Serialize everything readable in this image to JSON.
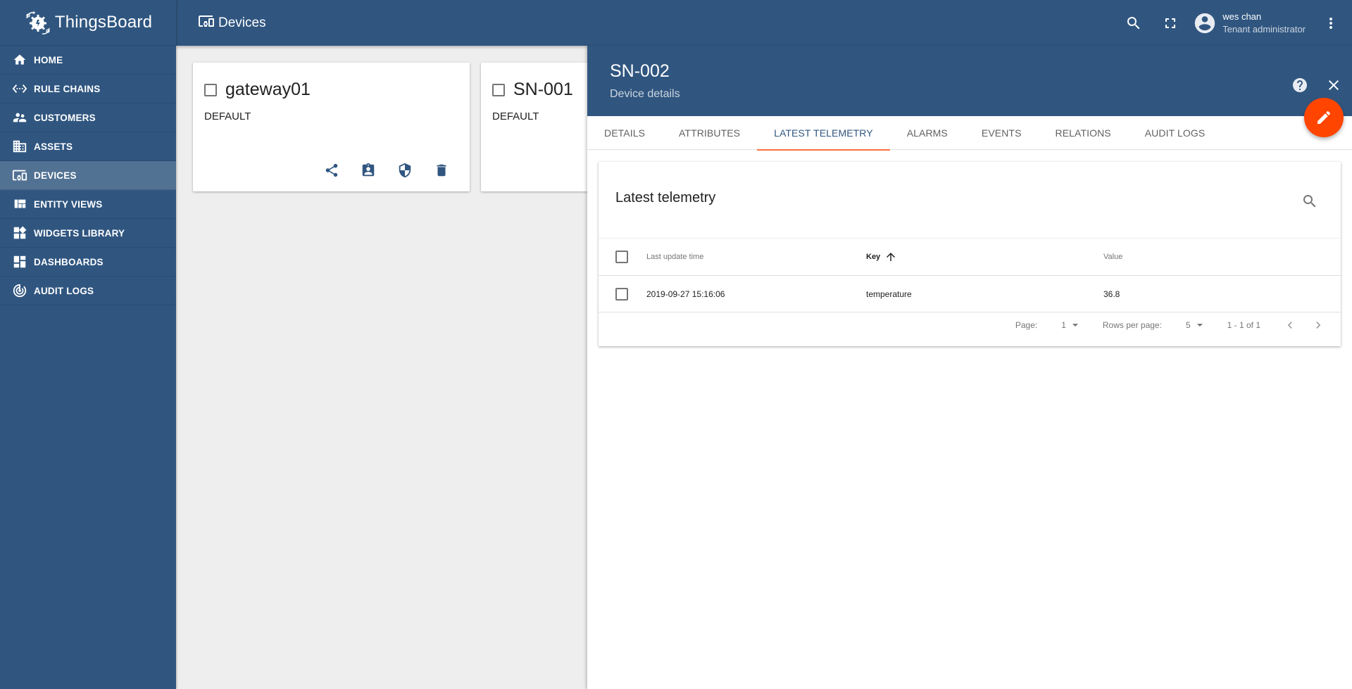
{
  "app": {
    "brand": "ThingsBoard"
  },
  "toolbar": {
    "page_title": "Devices",
    "icons": [
      "search-icon",
      "fullscreen-icon",
      "account-circle-icon",
      "more-vert-icon"
    ],
    "user_name": "wes chan",
    "user_role": "Tenant administrator"
  },
  "sidebar": {
    "items": [
      {
        "label": "HOME",
        "icon": "home-icon",
        "active": false
      },
      {
        "label": "RULE CHAINS",
        "icon": "settings-ethernet-icon",
        "active": false
      },
      {
        "label": "CUSTOMERS",
        "icon": "supervisor-account-icon",
        "active": false
      },
      {
        "label": "ASSETS",
        "icon": "domain-icon",
        "active": false
      },
      {
        "label": "DEVICES",
        "icon": "devices-other-icon",
        "active": true
      },
      {
        "label": "ENTITY VIEWS",
        "icon": "view-quilt-icon",
        "active": false
      },
      {
        "label": "WIDGETS LIBRARY",
        "icon": "widgets-icon",
        "active": false
      },
      {
        "label": "DASHBOARDS",
        "icon": "dashboard-icon",
        "active": false
      },
      {
        "label": "AUDIT LOGS",
        "icon": "track-changes-icon",
        "active": false
      }
    ]
  },
  "devices": {
    "cards": [
      {
        "name": "gateway01",
        "type": "DEFAULT",
        "actions": [
          "share-icon",
          "assign-customer-icon",
          "credentials-icon",
          "delete-icon"
        ]
      },
      {
        "name": "SN-001",
        "type": "DEFAULT"
      }
    ]
  },
  "details": {
    "title": "SN-002",
    "subtitle": "Device details",
    "tabs": [
      {
        "label": "DETAILS",
        "active": false
      },
      {
        "label": "ATTRIBUTES",
        "active": false
      },
      {
        "label": "LATEST TELEMETRY",
        "active": true
      },
      {
        "label": "ALARMS",
        "active": false
      },
      {
        "label": "EVENTS",
        "active": false
      },
      {
        "label": "RELATIONS",
        "active": false
      },
      {
        "label": "AUDIT LOGS",
        "active": false
      }
    ],
    "telemetry": {
      "title": "Latest telemetry",
      "columns": [
        "Last update time",
        "Key",
        "Value"
      ],
      "sort": {
        "column": "Key",
        "direction": "ascending"
      },
      "rows": [
        {
          "last_update_time": "2019-09-27 15:16:06",
          "key": "temperature",
          "value": "36.8"
        }
      ],
      "pagination": {
        "page_label": "Page:",
        "page": "1",
        "rows_label": "Rows per page:",
        "rows_per_page": "5",
        "range": "1 - 1 of 1"
      }
    }
  },
  "colors": {
    "primary": "#305680",
    "sidebar_active": "#527294",
    "accent": "#ff4500",
    "tab_indicator": "#ff7043"
  }
}
